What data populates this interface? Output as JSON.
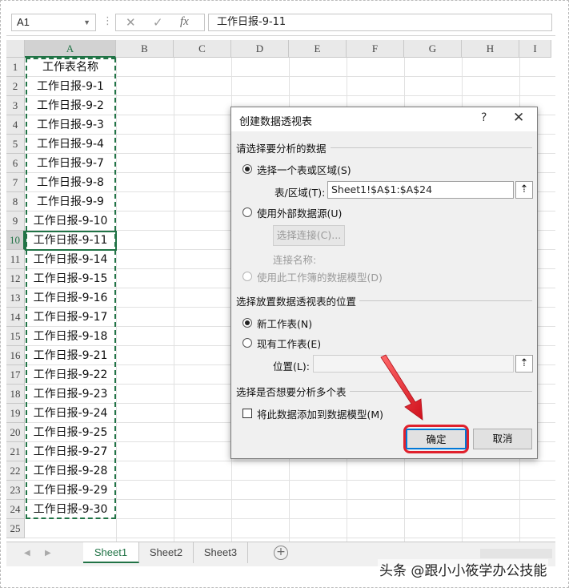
{
  "formula_bar": {
    "name_box": "A1",
    "cancel_icon": "✕",
    "enter_icon": "✓",
    "function_icon": "fx",
    "value": "工作日报-9-11"
  },
  "columns": [
    "A",
    "B",
    "C",
    "D",
    "E",
    "F",
    "G",
    "H",
    "I"
  ],
  "rows": [
    "1",
    "2",
    "3",
    "4",
    "5",
    "6",
    "7",
    "8",
    "9",
    "10",
    "11",
    "12",
    "13",
    "14",
    "15",
    "16",
    "17",
    "18",
    "19",
    "20",
    "21",
    "22",
    "23",
    "24",
    "25"
  ],
  "column_a": [
    "工作表名称",
    "工作日报-9-1",
    "工作日报-9-2",
    "工作日报-9-3",
    "工作日报-9-4",
    "工作日报-9-7",
    "工作日报-9-8",
    "工作日报-9-9",
    "工作日报-9-10",
    "工作日报-9-11",
    "工作日报-9-14",
    "工作日报-9-15",
    "工作日报-9-16",
    "工作日报-9-17",
    "工作日报-9-18",
    "工作日报-9-21",
    "工作日报-9-22",
    "工作日报-9-23",
    "工作日报-9-24",
    "工作日报-9-25",
    "工作日报-9-27",
    "工作日报-9-28",
    "工作日报-9-29",
    "工作日报-9-30"
  ],
  "sheet_tabs": [
    "Sheet1",
    "Sheet2",
    "Sheet3"
  ],
  "active_sheet": "Sheet1",
  "add_sheet_label": "+",
  "watermark": "头条 @跟小小筱学办公技能",
  "dialog": {
    "title": "创建数据透视表",
    "help": "?",
    "close": "✕",
    "section_analyze": "请选择要分析的数据",
    "radio_table_range": "选择一个表或区域(S)",
    "table_range_label": "表/区域(T):",
    "table_range_value": "Sheet1!$A$1:$A$24",
    "radio_external": "使用外部数据源(U)",
    "choose_connection_button": "选择连接(C)...",
    "connection_name_label": "连接名称:",
    "radio_data_model": "使用此工作簿的数据模型(D)",
    "section_location": "选择放置数据透视表的位置",
    "radio_new_sheet": "新工作表(N)",
    "radio_existing_sheet": "现有工作表(E)",
    "location_label": "位置(L):",
    "location_value": "",
    "section_multiple": "选择是否想要分析多个表",
    "add_to_model_checkbox": "将此数据添加到数据模型(M)",
    "ok_button": "确定",
    "cancel_button": "取消",
    "ref_icon": "⇡"
  },
  "colors": {
    "excel_green": "#217346",
    "highlight_red": "#e0202c",
    "focus_blue": "#0078d7"
  }
}
